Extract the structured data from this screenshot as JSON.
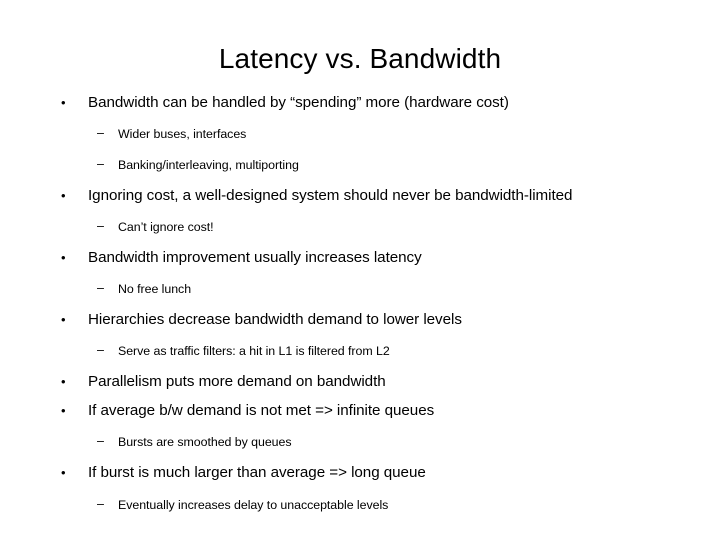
{
  "slide": {
    "title": "Latency vs. Bandwidth",
    "background_color": "#ffffff",
    "text_color": "#000000",
    "level1_marker": "•",
    "level2_marker": "–",
    "bullets": [
      {
        "level": 1,
        "text": "Bandwidth can be handled by “spending” more (hardware cost)"
      },
      {
        "level": 2,
        "text": "Wider buses, interfaces"
      },
      {
        "level": 2,
        "text": "Banking/interleaving, multiporting"
      },
      {
        "level": 1,
        "text": "Ignoring cost, a well-designed system should never be bandwidth-limited"
      },
      {
        "level": 2,
        "text": "Can’t ignore cost!"
      },
      {
        "level": 1,
        "text": "Bandwidth improvement usually increases latency"
      },
      {
        "level": 2,
        "text": "No free lunch"
      },
      {
        "level": 1,
        "text": "Hierarchies decrease bandwidth demand to lower levels"
      },
      {
        "level": 2,
        "text": "Serve as traffic filters: a hit in L1 is filtered from L2"
      },
      {
        "level": 1,
        "text": "Parallelism puts more demand on bandwidth"
      },
      {
        "level": 1,
        "text": "If average b/w demand is not met => infinite queues"
      },
      {
        "level": 2,
        "text": "Bursts are smoothed by queues"
      },
      {
        "level": 1,
        "text": "If burst is much larger than average => long queue"
      },
      {
        "level": 2,
        "text": "Eventually increases delay to unacceptable levels"
      }
    ]
  }
}
